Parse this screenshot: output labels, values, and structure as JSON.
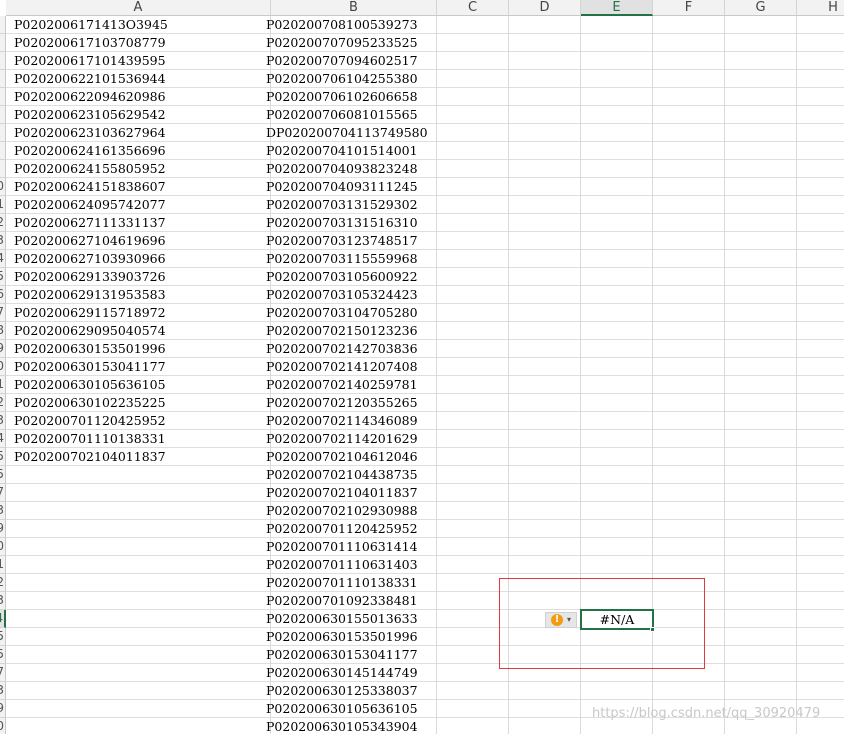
{
  "columns": [
    {
      "letter": "A",
      "active": false
    },
    {
      "letter": "B",
      "active": false
    },
    {
      "letter": "C",
      "active": false
    },
    {
      "letter": "D",
      "active": false
    },
    {
      "letter": "E",
      "active": true
    },
    {
      "letter": "F",
      "active": false
    },
    {
      "letter": "G",
      "active": false
    },
    {
      "letter": "H",
      "active": false
    }
  ],
  "row_labels": [
    "",
    "",
    "",
    "",
    "",
    "",
    "",
    "",
    "",
    "0",
    "1",
    "2",
    "3",
    "4",
    "5",
    "6",
    "7",
    "8",
    "9",
    "0",
    "1",
    "2",
    "3",
    "4",
    "5",
    "5",
    "7",
    "3",
    "9",
    "0",
    "1",
    "2",
    "3",
    "4",
    "5",
    "5",
    "7",
    "3",
    "9",
    "0"
  ],
  "active_row_index": 33,
  "column_a": [
    "P0202006171413O3945",
    "P020200617103708779",
    "P020200617101439595",
    "P020200622101536944",
    "P020200622094620986",
    "P020200623105629542",
    "P020200623103627964",
    "P020200624161356696",
    "P020200624155805952",
    "P020200624151838607",
    "P020200624095742077",
    "P020200627111331137",
    "P020200627104619696",
    "P020200627103930966",
    "P020200629133903726",
    "P020200629131953583",
    "P020200629115718972",
    "P020200629095040574",
    "P020200630153501996",
    "P020200630153041177",
    "P020200630105636105",
    "P020200630102235225",
    "P020200701120425952",
    "P020200701110138331",
    "P020200702104011837"
  ],
  "column_b": [
    "P020200708100539273",
    "P020200707095233525",
    "P020200707094602517",
    "P020200706104255380",
    "P020200706102606658",
    "P020200706081015565",
    "DP020200704113749580",
    "P020200704101514001",
    "P020200704093823248",
    "P020200704093111245",
    "P020200703131529302",
    "P020200703131516310",
    "P020200703123748517",
    "P020200703115559968",
    "P020200703105600922",
    "P020200703105324423",
    "P020200703104705280",
    "P020200702150123236",
    "P020200702142703836",
    "P020200702141207408",
    "P020200702140259781",
    "P020200702120355265",
    "P020200702114346089",
    "P020200702114201629",
    "P020200702104612046",
    "P020200702104438735",
    "P020200702104011837",
    "P020200702102930988",
    "P020200701120425952",
    "P020200701110631414",
    "P020200701110631403",
    "P020200701110138331",
    "P020200701092338481",
    "P020200630155013633",
    "P020200630153501996",
    "P020200630153041177",
    "P020200630145144749",
    "P020200630125338037",
    "P020200630105636105",
    "P020200630105343904"
  ],
  "selected_cell_value": "#N/A",
  "error_button": {
    "icon": "warning-icon",
    "symbol": "!",
    "dropdown": "▾"
  },
  "colors": {
    "accent": "#217346",
    "warning": "#f39c12",
    "highlight_box": "#e0393e"
  },
  "watermark": "https://blog.csdn.net/qq_30920479"
}
